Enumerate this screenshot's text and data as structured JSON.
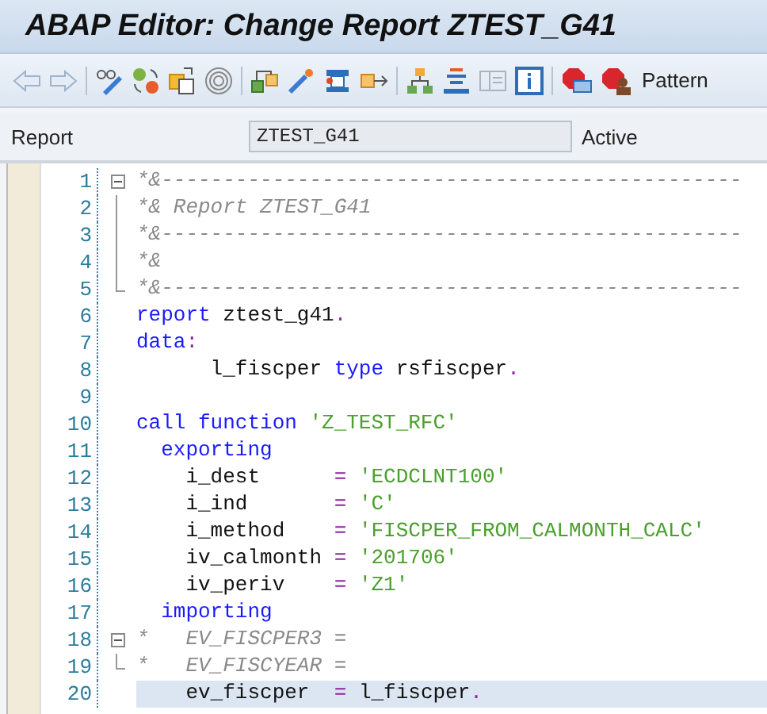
{
  "window": {
    "title": "ABAP Editor: Change Report ZTEST_G41"
  },
  "toolbar": {
    "pattern_button": "Pattern"
  },
  "header": {
    "label": "Report",
    "value": "ZTEST_G41",
    "status": "Active"
  },
  "editor": {
    "lines": [
      {
        "number": "1",
        "kind": "fold-start",
        "selected": false,
        "tokens": [
          {
            "kind": "comment",
            "text": "*&-----------------------------------------------"
          }
        ]
      },
      {
        "number": "2",
        "kind": "fold-inner",
        "selected": false,
        "tokens": [
          {
            "kind": "comment",
            "text": "*& Report ZTEST_G41"
          }
        ]
      },
      {
        "number": "3",
        "kind": "fold-inner",
        "selected": false,
        "tokens": [
          {
            "kind": "comment",
            "text": "*&-----------------------------------------------"
          }
        ]
      },
      {
        "number": "4",
        "kind": "fold-inner",
        "selected": false,
        "tokens": [
          {
            "kind": "comment",
            "text": "*&"
          }
        ]
      },
      {
        "number": "5",
        "kind": "fold-end",
        "selected": false,
        "tokens": [
          {
            "kind": "comment",
            "text": "*&-----------------------------------------------"
          }
        ]
      },
      {
        "number": "6",
        "selected": false,
        "tokens": [
          {
            "kind": "keyword",
            "text": "report"
          },
          {
            "kind": "plain",
            "text": " ztest_g41"
          },
          {
            "kind": "op",
            "text": "."
          }
        ]
      },
      {
        "number": "7",
        "selected": false,
        "tokens": [
          {
            "kind": "keyword",
            "text": "data"
          },
          {
            "kind": "op",
            "text": ":"
          }
        ]
      },
      {
        "number": "8",
        "selected": false,
        "tokens": [
          {
            "kind": "plain",
            "text": "      l_fiscper "
          },
          {
            "kind": "keyword",
            "text": "type"
          },
          {
            "kind": "plain",
            "text": " rsfiscper"
          },
          {
            "kind": "op",
            "text": "."
          }
        ]
      },
      {
        "number": "9",
        "selected": false
      },
      {
        "number": "10",
        "selected": false,
        "tokens": [
          {
            "kind": "keyword",
            "text": "call function "
          },
          {
            "kind": "string",
            "text": "'Z_TEST_RFC'"
          }
        ]
      },
      {
        "number": "11",
        "selected": false,
        "tokens": [
          {
            "kind": "keyword",
            "text": "  exporting"
          }
        ]
      },
      {
        "number": "12",
        "selected": false,
        "tokens": [
          {
            "kind": "plain",
            "text": "    i_dest      "
          },
          {
            "kind": "op",
            "text": "= "
          },
          {
            "kind": "string",
            "text": "'ECDCLNT100'"
          }
        ]
      },
      {
        "number": "13",
        "selected": false,
        "tokens": [
          {
            "kind": "plain",
            "text": "    i_ind       "
          },
          {
            "kind": "op",
            "text": "= "
          },
          {
            "kind": "string",
            "text": "'C'"
          }
        ]
      },
      {
        "number": "14",
        "selected": false,
        "tokens": [
          {
            "kind": "plain",
            "text": "    i_method    "
          },
          {
            "kind": "op",
            "text": "= "
          },
          {
            "kind": "string",
            "text": "'FISCPER_FROM_CALMONTH_CALC'"
          }
        ]
      },
      {
        "number": "15",
        "selected": false,
        "tokens": [
          {
            "kind": "plain",
            "text": "    iv_calmonth "
          },
          {
            "kind": "op",
            "text": "= "
          },
          {
            "kind": "string",
            "text": "'201706'"
          }
        ]
      },
      {
        "number": "16",
        "selected": false,
        "tokens": [
          {
            "kind": "plain",
            "text": "    iv_periv    "
          },
          {
            "kind": "op",
            "text": "= "
          },
          {
            "kind": "string",
            "text": "'Z1'"
          }
        ]
      },
      {
        "number": "17",
        "selected": false,
        "tokens": [
          {
            "kind": "keyword",
            "text": "  importing"
          }
        ]
      },
      {
        "number": "18",
        "kind": "fold-start",
        "selected": false,
        "tokens": [
          {
            "kind": "comment",
            "text": "*   EV_FISCPER3 ="
          }
        ]
      },
      {
        "number": "19",
        "kind": "fold-end",
        "selected": false,
        "tokens": [
          {
            "kind": "comment",
            "text": "*   EV_FISCYEAR ="
          }
        ]
      },
      {
        "number": "20",
        "selected": true,
        "tokens": [
          {
            "kind": "plain",
            "text": "    ev_fiscper  "
          },
          {
            "kind": "op",
            "text": "="
          },
          {
            "kind": "plain",
            "text": " l_fiscper"
          },
          {
            "kind": "op",
            "text": "."
          }
        ]
      }
    ]
  }
}
